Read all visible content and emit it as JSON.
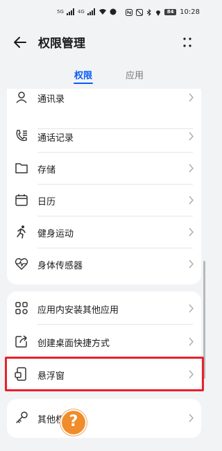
{
  "status_bar": {
    "left_chips": [
      "5G",
      "4G"
    ],
    "battery": "84",
    "time": "10:28"
  },
  "header": {
    "title": "权限管理"
  },
  "tabs": [
    {
      "label": "权限",
      "active": true
    },
    {
      "label": "应用",
      "active": false
    }
  ],
  "permissions_group_1": [
    {
      "label": "通讯录",
      "icon": "contacts-icon"
    },
    {
      "label": "通话记录",
      "icon": "call-log-icon"
    },
    {
      "label": "存储",
      "icon": "folder-icon"
    },
    {
      "label": "日历",
      "icon": "calendar-icon"
    },
    {
      "label": "健身运动",
      "icon": "running-icon"
    },
    {
      "label": "身体传感器",
      "icon": "heart-rate-icon"
    }
  ],
  "permissions_group_2": [
    {
      "label": "应用内安装其他应用",
      "icon": "apps-grid-icon"
    },
    {
      "label": "创建桌面快捷方式",
      "icon": "shortcut-icon"
    },
    {
      "label": "悬浮窗",
      "icon": "floating-window-icon"
    }
  ],
  "permissions_group_3": [
    {
      "label": "其他权限",
      "icon": "key-icon"
    }
  ],
  "help_badge": "?",
  "colors": {
    "accent": "#0a59f7",
    "highlight": "#e8202a",
    "badge": "#f08c2b"
  }
}
